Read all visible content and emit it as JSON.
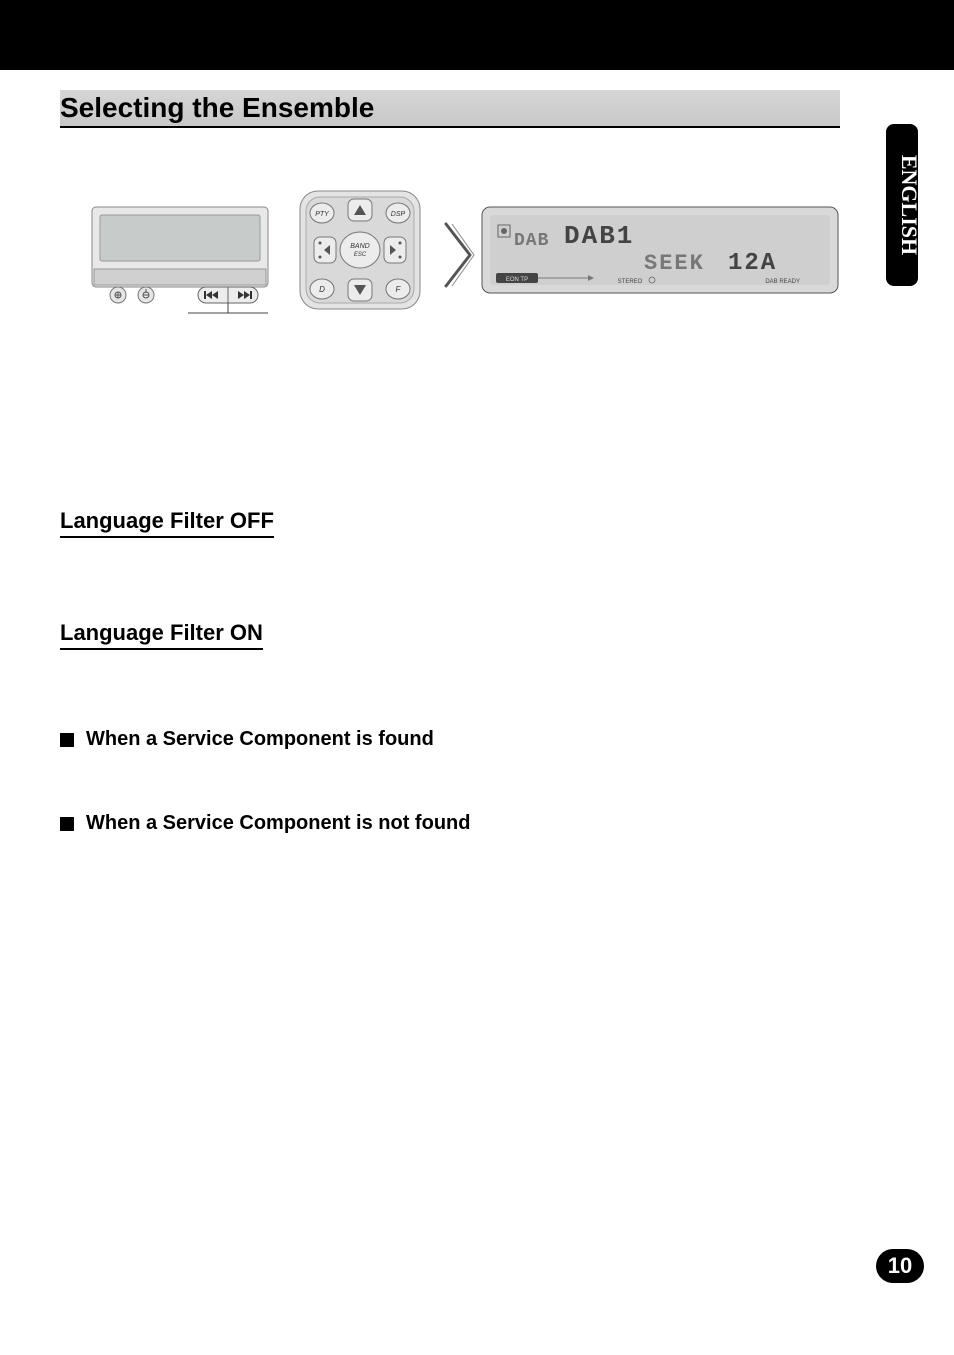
{
  "header": {
    "section_title": "Selecting the Ensemble"
  },
  "side_tab": {
    "language": "ENGLISH"
  },
  "subsections": {
    "filter_off": "Language Filter OFF",
    "filter_on": "Language Filter ON",
    "found": "When a Service Component is found",
    "not_found": "When a Service Component is not found"
  },
  "page_number": "10",
  "figures": {
    "remote_labels": {
      "pty": "PTY",
      "dsp": "DSP",
      "band": "BAND",
      "esc": "ESC"
    },
    "lcd": {
      "icon1": "DAB",
      "line1": "DAB1",
      "line2a": "SEEK",
      "line2b": "12A",
      "badge_left": "EON  TP",
      "small_center": "STEREO",
      "small_right": "DAB READY"
    }
  }
}
